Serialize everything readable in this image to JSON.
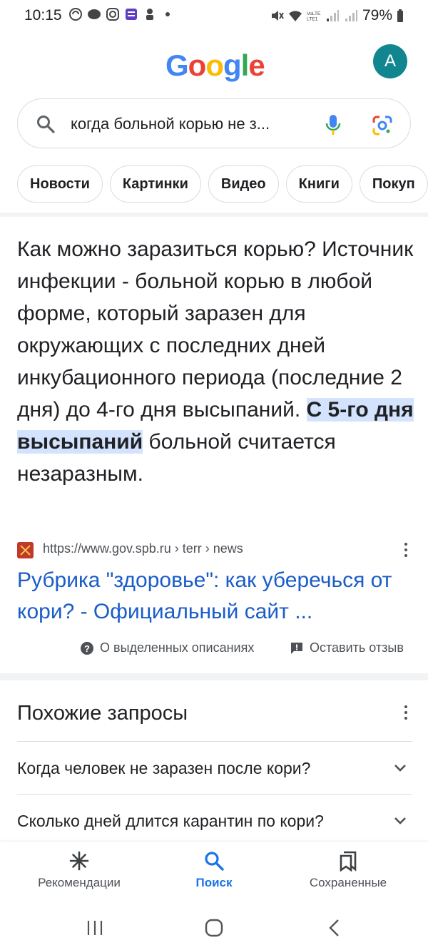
{
  "status_bar": {
    "time": "10:15",
    "battery": "79%"
  },
  "header": {
    "logo": "Google",
    "avatar_letter": "A"
  },
  "search": {
    "query": "когда больной корью не з..."
  },
  "chips": [
    "Новости",
    "Картинки",
    "Видео",
    "Книги",
    "Покуп"
  ],
  "snippet": {
    "text_before": "Как можно заразиться корью? Источник инфекции - больной корью в любой форме, который заразен для окружающих с последних дней инкубационного периода (последние 2 дня) до 4-го дня высыпаний. ",
    "highlight": "С 5-го дня высыпаний",
    "text_after": " больной считается незаразным."
  },
  "source": {
    "url": "https://www.gov.spb.ru › terr › news",
    "title": "Рубрика \"здоровье\": как уберечься от кори? - Официальный сайт ..."
  },
  "footer_links": {
    "about": "О выделенных описаниях",
    "feedback": "Оставить отзыв"
  },
  "related": {
    "title": "Похожие запросы",
    "items": [
      "Когда человек не заразен после кори?",
      "Сколько дней длится карантин по кори?"
    ]
  },
  "bottom_nav": {
    "items": [
      {
        "label": "Рекомендации",
        "icon": "asterisk-icon"
      },
      {
        "label": "Поиск",
        "icon": "search-icon"
      },
      {
        "label": "Сохраненные",
        "icon": "bookmarks-icon"
      }
    ]
  },
  "colors": {
    "accent": "#1a73e8",
    "link": "#1a5cc8",
    "highlight": "#d3e3fd",
    "avatar": "#12868f"
  }
}
